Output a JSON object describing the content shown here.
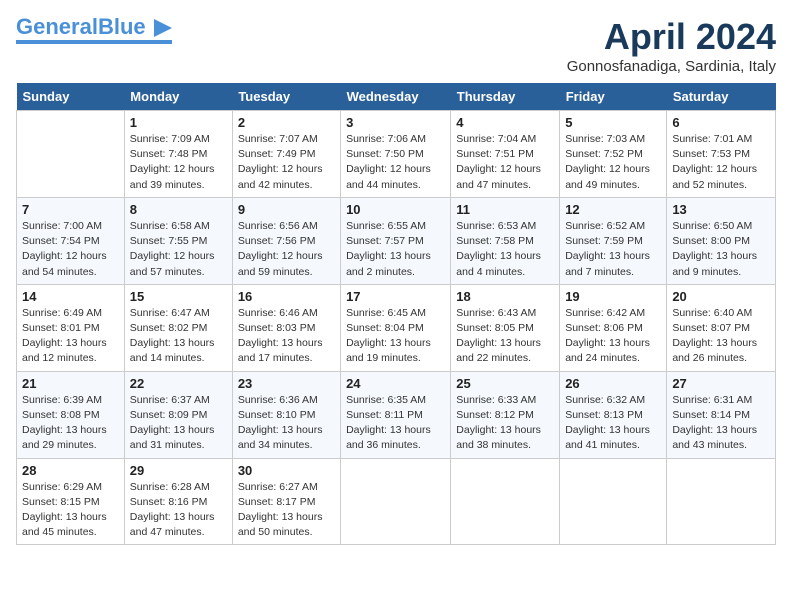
{
  "header": {
    "logo_general": "General",
    "logo_blue": "Blue",
    "title": "April 2024",
    "location": "Gonnosfanadiga, Sardinia, Italy"
  },
  "days_of_week": [
    "Sunday",
    "Monday",
    "Tuesday",
    "Wednesday",
    "Thursday",
    "Friday",
    "Saturday"
  ],
  "weeks": [
    [
      {
        "day": "",
        "sunrise": "",
        "sunset": "",
        "daylight": ""
      },
      {
        "day": "1",
        "sunrise": "Sunrise: 7:09 AM",
        "sunset": "Sunset: 7:48 PM",
        "daylight": "Daylight: 12 hours and 39 minutes."
      },
      {
        "day": "2",
        "sunrise": "Sunrise: 7:07 AM",
        "sunset": "Sunset: 7:49 PM",
        "daylight": "Daylight: 12 hours and 42 minutes."
      },
      {
        "day": "3",
        "sunrise": "Sunrise: 7:06 AM",
        "sunset": "Sunset: 7:50 PM",
        "daylight": "Daylight: 12 hours and 44 minutes."
      },
      {
        "day": "4",
        "sunrise": "Sunrise: 7:04 AM",
        "sunset": "Sunset: 7:51 PM",
        "daylight": "Daylight: 12 hours and 47 minutes."
      },
      {
        "day": "5",
        "sunrise": "Sunrise: 7:03 AM",
        "sunset": "Sunset: 7:52 PM",
        "daylight": "Daylight: 12 hours and 49 minutes."
      },
      {
        "day": "6",
        "sunrise": "Sunrise: 7:01 AM",
        "sunset": "Sunset: 7:53 PM",
        "daylight": "Daylight: 12 hours and 52 minutes."
      }
    ],
    [
      {
        "day": "7",
        "sunrise": "Sunrise: 7:00 AM",
        "sunset": "Sunset: 7:54 PM",
        "daylight": "Daylight: 12 hours and 54 minutes."
      },
      {
        "day": "8",
        "sunrise": "Sunrise: 6:58 AM",
        "sunset": "Sunset: 7:55 PM",
        "daylight": "Daylight: 12 hours and 57 minutes."
      },
      {
        "day": "9",
        "sunrise": "Sunrise: 6:56 AM",
        "sunset": "Sunset: 7:56 PM",
        "daylight": "Daylight: 12 hours and 59 minutes."
      },
      {
        "day": "10",
        "sunrise": "Sunrise: 6:55 AM",
        "sunset": "Sunset: 7:57 PM",
        "daylight": "Daylight: 13 hours and 2 minutes."
      },
      {
        "day": "11",
        "sunrise": "Sunrise: 6:53 AM",
        "sunset": "Sunset: 7:58 PM",
        "daylight": "Daylight: 13 hours and 4 minutes."
      },
      {
        "day": "12",
        "sunrise": "Sunrise: 6:52 AM",
        "sunset": "Sunset: 7:59 PM",
        "daylight": "Daylight: 13 hours and 7 minutes."
      },
      {
        "day": "13",
        "sunrise": "Sunrise: 6:50 AM",
        "sunset": "Sunset: 8:00 PM",
        "daylight": "Daylight: 13 hours and 9 minutes."
      }
    ],
    [
      {
        "day": "14",
        "sunrise": "Sunrise: 6:49 AM",
        "sunset": "Sunset: 8:01 PM",
        "daylight": "Daylight: 13 hours and 12 minutes."
      },
      {
        "day": "15",
        "sunrise": "Sunrise: 6:47 AM",
        "sunset": "Sunset: 8:02 PM",
        "daylight": "Daylight: 13 hours and 14 minutes."
      },
      {
        "day": "16",
        "sunrise": "Sunrise: 6:46 AM",
        "sunset": "Sunset: 8:03 PM",
        "daylight": "Daylight: 13 hours and 17 minutes."
      },
      {
        "day": "17",
        "sunrise": "Sunrise: 6:45 AM",
        "sunset": "Sunset: 8:04 PM",
        "daylight": "Daylight: 13 hours and 19 minutes."
      },
      {
        "day": "18",
        "sunrise": "Sunrise: 6:43 AM",
        "sunset": "Sunset: 8:05 PM",
        "daylight": "Daylight: 13 hours and 22 minutes."
      },
      {
        "day": "19",
        "sunrise": "Sunrise: 6:42 AM",
        "sunset": "Sunset: 8:06 PM",
        "daylight": "Daylight: 13 hours and 24 minutes."
      },
      {
        "day": "20",
        "sunrise": "Sunrise: 6:40 AM",
        "sunset": "Sunset: 8:07 PM",
        "daylight": "Daylight: 13 hours and 26 minutes."
      }
    ],
    [
      {
        "day": "21",
        "sunrise": "Sunrise: 6:39 AM",
        "sunset": "Sunset: 8:08 PM",
        "daylight": "Daylight: 13 hours and 29 minutes."
      },
      {
        "day": "22",
        "sunrise": "Sunrise: 6:37 AM",
        "sunset": "Sunset: 8:09 PM",
        "daylight": "Daylight: 13 hours and 31 minutes."
      },
      {
        "day": "23",
        "sunrise": "Sunrise: 6:36 AM",
        "sunset": "Sunset: 8:10 PM",
        "daylight": "Daylight: 13 hours and 34 minutes."
      },
      {
        "day": "24",
        "sunrise": "Sunrise: 6:35 AM",
        "sunset": "Sunset: 8:11 PM",
        "daylight": "Daylight: 13 hours and 36 minutes."
      },
      {
        "day": "25",
        "sunrise": "Sunrise: 6:33 AM",
        "sunset": "Sunset: 8:12 PM",
        "daylight": "Daylight: 13 hours and 38 minutes."
      },
      {
        "day": "26",
        "sunrise": "Sunrise: 6:32 AM",
        "sunset": "Sunset: 8:13 PM",
        "daylight": "Daylight: 13 hours and 41 minutes."
      },
      {
        "day": "27",
        "sunrise": "Sunrise: 6:31 AM",
        "sunset": "Sunset: 8:14 PM",
        "daylight": "Daylight: 13 hours and 43 minutes."
      }
    ],
    [
      {
        "day": "28",
        "sunrise": "Sunrise: 6:29 AM",
        "sunset": "Sunset: 8:15 PM",
        "daylight": "Daylight: 13 hours and 45 minutes."
      },
      {
        "day": "29",
        "sunrise": "Sunrise: 6:28 AM",
        "sunset": "Sunset: 8:16 PM",
        "daylight": "Daylight: 13 hours and 47 minutes."
      },
      {
        "day": "30",
        "sunrise": "Sunrise: 6:27 AM",
        "sunset": "Sunset: 8:17 PM",
        "daylight": "Daylight: 13 hours and 50 minutes."
      },
      {
        "day": "",
        "sunrise": "",
        "sunset": "",
        "daylight": ""
      },
      {
        "day": "",
        "sunrise": "",
        "sunset": "",
        "daylight": ""
      },
      {
        "day": "",
        "sunrise": "",
        "sunset": "",
        "daylight": ""
      },
      {
        "day": "",
        "sunrise": "",
        "sunset": "",
        "daylight": ""
      }
    ]
  ]
}
